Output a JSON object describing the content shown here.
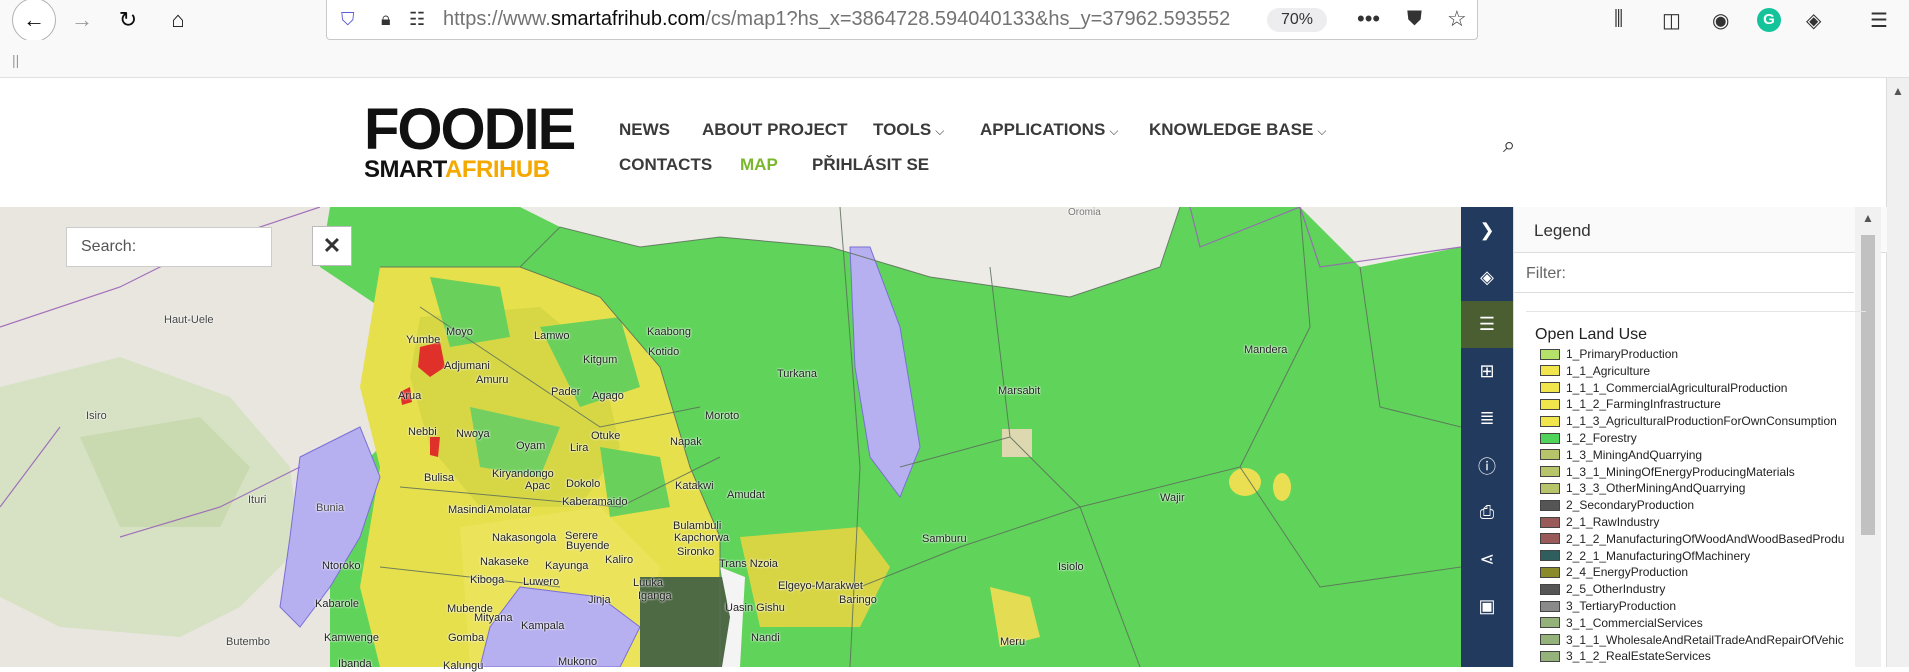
{
  "browser": {
    "url_prefix": "https://www.",
    "url_domain": "smartafrihub.com",
    "url_rest": "/cs/map1?hs_x=3864728.594040133&hs_y=37962.593552",
    "zoom": "70%"
  },
  "logo": {
    "top": "FOODIE",
    "smart": "SMART",
    "afri": "AFRIHUB"
  },
  "menu": {
    "news": "NEWS",
    "about": "ABOUT PROJECT",
    "tools": "TOOLS",
    "applications": "APPLICATIONS",
    "knowledge": "KNOWLEDGE BASE",
    "contacts": "CONTACTS",
    "map": "MAP",
    "login": "PŘIHLÁSIT SE"
  },
  "map": {
    "search_placeholder": "Search:",
    "close_label": "✕",
    "places": [
      "Haut-Uele",
      "Isiro",
      "Ituri",
      "Bunia",
      "Yumbe",
      "Moyo",
      "Adjumani",
      "Arua",
      "Nebbi",
      "Nwoya",
      "Amuru",
      "Lamwo",
      "Kitgum",
      "Kaabong",
      "Pader",
      "Agago",
      "Kotido",
      "Moroto",
      "Napak",
      "Otuke",
      "Oyam",
      "Lira",
      "Bulisa",
      "Kiryandongo",
      "Apac",
      "Dokolo",
      "Masindi",
      "Amolatar",
      "Kaberamaido",
      "Katakwi",
      "Amudat",
      "Nakasongola",
      "Serere",
      "Buyende",
      "Bulambuli",
      "Kapchorwa",
      "Sironko",
      "Nakaseke",
      "Kiboga",
      "Kayunga",
      "Kaliro",
      "Luuka",
      "Iganga",
      "Jinja",
      "Luwero",
      "Mukono",
      "Kampala",
      "Mityana",
      "Mubende",
      "Gomba",
      "Kalungu",
      "Kabarole",
      "Ntoroko",
      "Kamwenge",
      "Ibanda",
      "Butembo",
      "Turkana",
      "Marsabit",
      "Samburu",
      "Isiolo",
      "Wajir",
      "Mandera",
      "Trans Nzoia",
      "Elgeyo-Marakwet",
      "Uasin Gishu",
      "Baringo",
      "Nandi",
      "Meru",
      "Oromia"
    ]
  },
  "sidebar": {
    "items": [
      "chevron-right-icon",
      "layers-icon",
      "legend-list-icon",
      "map-icon",
      "database-icon",
      "info-icon",
      "print-icon",
      "share-icon",
      "save-icon"
    ]
  },
  "legend": {
    "title": "Legend",
    "filter_placeholder": "Filter:",
    "group": "Open Land Use",
    "items": [
      {
        "label": "1_PrimaryProduction",
        "color": "#b5e06a"
      },
      {
        "label": "1_1_Agriculture",
        "color": "#f0e54a"
      },
      {
        "label": "1_1_1_CommercialAgriculturalProduction",
        "color": "#f0e54a"
      },
      {
        "label": "1_1_2_FarmingInfrastructure",
        "color": "#f0e54a"
      },
      {
        "label": "1_1_3_AgriculturalProductionForOwnConsumption",
        "color": "#f0e54a"
      },
      {
        "label": "1_2_Forestry",
        "color": "#4fd35a"
      },
      {
        "label": "1_3_MiningAndQuarrying",
        "color": "#b8c46a"
      },
      {
        "label": "1_3_1_MiningOfEnergyProducingMaterials",
        "color": "#b8c46a"
      },
      {
        "label": "1_3_3_OtherMiningAndQuarrying",
        "color": "#b8c46a"
      },
      {
        "label": "2_SecondaryProduction",
        "color": "#555555"
      },
      {
        "label": "2_1_RawIndustry",
        "color": "#9a5a5a"
      },
      {
        "label": "2_1_2_ManufacturingOfWoodAndWoodBasedProdu",
        "color": "#9a5a5a"
      },
      {
        "label": "2_2_1_ManufacturingOfMachinery",
        "color": "#2e5e5e"
      },
      {
        "label": "2_4_EnergyProduction",
        "color": "#8a8a2a"
      },
      {
        "label": "2_5_OtherIndustry",
        "color": "#555555"
      },
      {
        "label": "3_TertiaryProduction",
        "color": "#8a8a8a"
      },
      {
        "label": "3_1_CommercialServices",
        "color": "#94b27a"
      },
      {
        "label": "3_1_1_WholesaleAndRetailTradeAndRepairOfVehic",
        "color": "#94b27a"
      },
      {
        "label": "3_1_2_RealEstateServices",
        "color": "#94b27a"
      }
    ]
  }
}
